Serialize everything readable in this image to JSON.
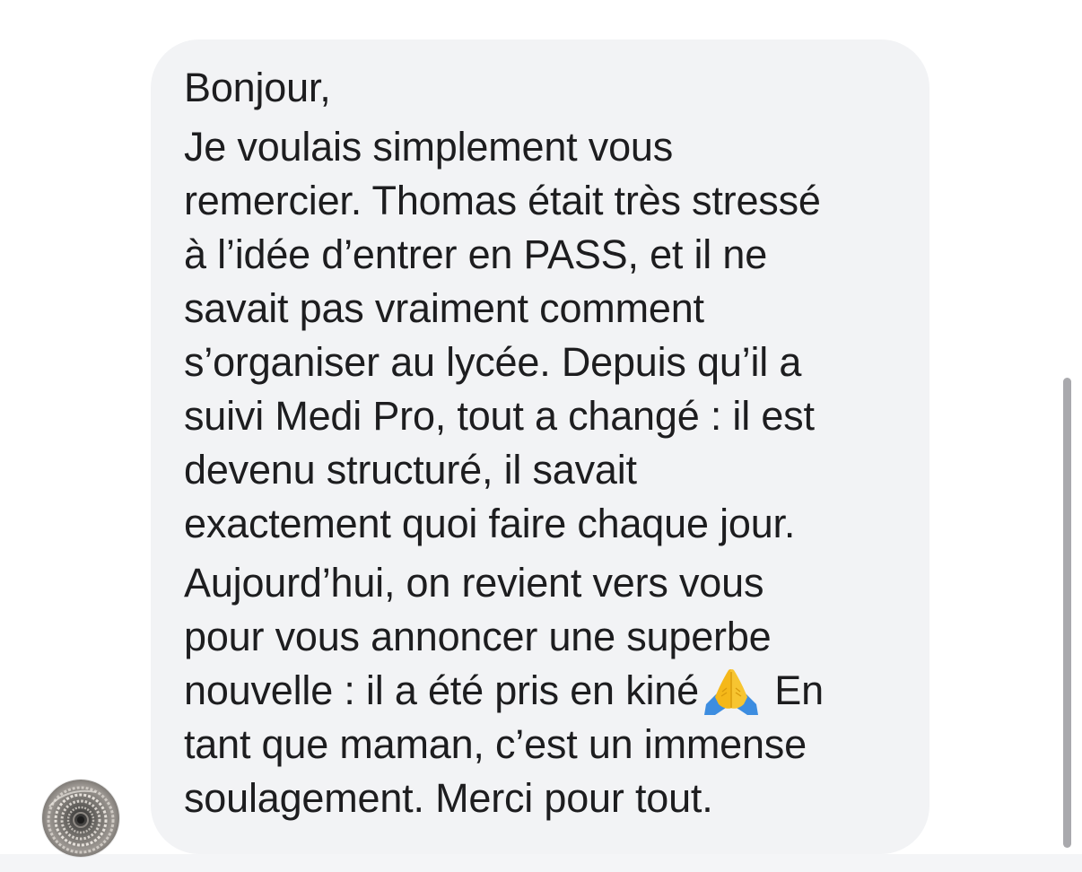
{
  "conversation": {
    "message": {
      "paragraphs": [
        "Bonjour,",
        "Je voulais simplement vous\nremercier. Thomas était très stressé\nà l’idée d’entrer en PASS, et il ne\nsavait pas vraiment comment\ns’organiser au lycée. Depuis qu’il a\nsuivi Medi Pro, tout a changé : il est\ndevenu structuré, il savait\nexactement quoi faire chaque jour."
      ],
      "last_paragraph_before_emoji": "Aujourd’hui, on revient vers vous\npour vous annoncer une superbe\nnouvelle : il a été pris en kiné",
      "emoji": "folded-hands",
      "last_paragraph_after_emoji": "En\ntant que maman, c’est un immense\nsoulagement. Merci pour tout."
    },
    "sender_avatar": "spiral-staircase-photo",
    "bubble_color": "#f2f3f5",
    "text_color": "#1d1d1f"
  },
  "scrollbar": {
    "position_fraction": 0.54,
    "visible_fraction": 0.54
  }
}
